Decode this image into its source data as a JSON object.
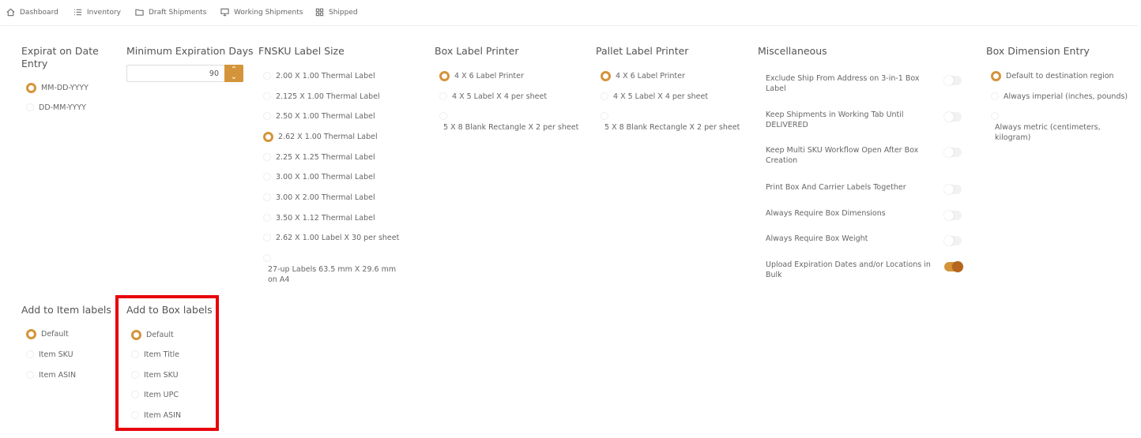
{
  "nav": [
    {
      "label": "Dashboard",
      "icon": "home-icon"
    },
    {
      "label": "Inventory",
      "icon": "list-icon"
    },
    {
      "label": "Draft Shipments",
      "icon": "folder-icon"
    },
    {
      "label": "Working Shipments",
      "icon": "monitor-icon"
    },
    {
      "label": "Shipped",
      "icon": "grid-icon"
    }
  ],
  "expiration": {
    "title": "Expirat on Date Entry",
    "options": [
      "MM-DD-YYYY",
      "DD-MM-YYYY"
    ],
    "selected": "MM-DD-YYYY"
  },
  "min_exp": {
    "title": "Minimum Expiration Days",
    "value": "90"
  },
  "fnsku": {
    "title": "FNSKU Label Size",
    "options": [
      "2.00 X 1.00 Thermal Label",
      "2.125 X 1.00 Thermal Label",
      "2.50 X 1.00 Thermal Label",
      "2.62 X 1.00 Thermal Label",
      "2.25 X 1.25 Thermal Label",
      "3.00 X 1.00 Thermal Label",
      "3.00 X 2.00 Thermal Label",
      "3.50 X 1.12 Thermal Label",
      "2.62 X 1.00 Label X 30 per sheet",
      "27-up Labels 63.5 mm X 29.6 mm on A4"
    ],
    "selected": "2.62 X 1.00 Thermal Label"
  },
  "box_printer": {
    "title": "Box Label Printer",
    "options": [
      "4 X 6 Label Printer",
      "4 X 5 Label X 4 per sheet",
      "5 X 8 Blank Rectangle X 2 per sheet"
    ],
    "selected": "4 X 6 Label Printer"
  },
  "pallet_printer": {
    "title": "Pallet Label Printer",
    "options": [
      "4 X 6 Label Printer",
      "4 X 5 Label X 4 per sheet",
      "5 X 8 Blank Rectangle X 2 per sheet"
    ],
    "selected": "4 X 6 Label Printer"
  },
  "misc": {
    "title": "Miscellaneous",
    "items": [
      {
        "label": "Exclude Ship From Address on 3-in-1 Box Label",
        "on": false
      },
      {
        "label": "Keep Shipments in Working Tab Until DELIVERED",
        "on": false
      },
      {
        "label": "Keep Multi SKU Workflow Open After Box Creation",
        "on": false
      },
      {
        "label": "Print Box And Carrier Labels Together",
        "on": false
      },
      {
        "label": "Always Require Box Dimensions",
        "on": false
      },
      {
        "label": "Always Require Box Weight",
        "on": false
      },
      {
        "label": "Upload Expiration Dates and/or Locations in Bulk",
        "on": true
      }
    ]
  },
  "box_dim": {
    "title": "Box Dimension Entry",
    "options": [
      "Default to destination region",
      "Always imperial (inches, pounds)",
      "Always metric (centimeters, kilogram)"
    ],
    "selected": "Default to destination region"
  },
  "item_labels": {
    "title": "Add to Item labels",
    "options": [
      "Default",
      "Item SKU",
      "Item ASIN"
    ],
    "selected": "Default"
  },
  "box_labels": {
    "title": "Add to Box labels",
    "options": [
      "Default",
      "Item Title",
      "Item SKU",
      "Item UPC",
      "Item ASIN"
    ],
    "selected": "Default"
  },
  "colors": {
    "accent": "#d4943a",
    "highlight": "#e8000b"
  }
}
